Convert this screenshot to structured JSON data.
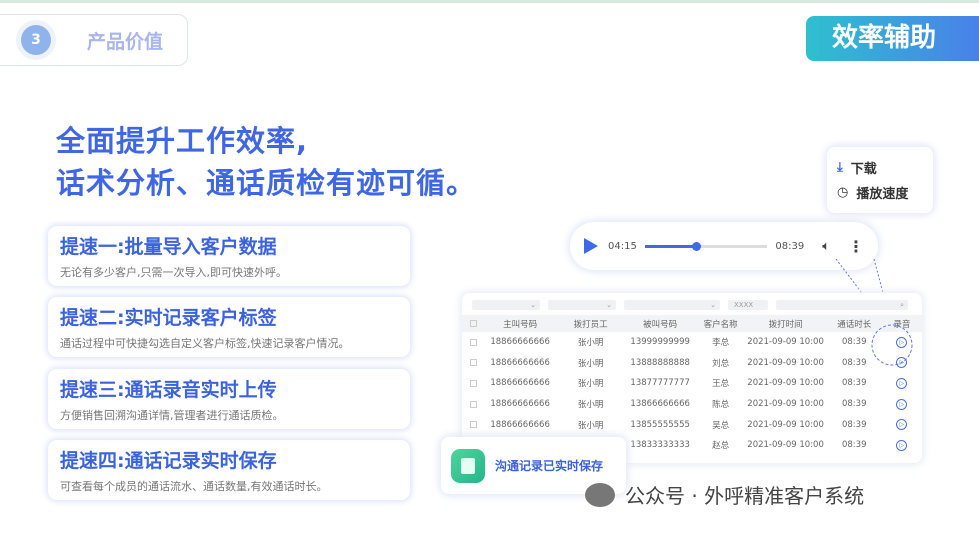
{
  "section": {
    "number": "3",
    "label": "产品价值"
  },
  "badge": "效率辅助",
  "headline": [
    "全面提升工作效率,",
    "话术分析、通话质检有迹可循。"
  ],
  "cards": [
    {
      "title": "提速一:批量导入客户数据",
      "desc": "无论有多少客户,只需一次导入,即可快速外呼。"
    },
    {
      "title": "提速二:实时记录客户标签",
      "desc": "通话过程中可快捷勾选自定义客户标签,快速记录客户情况。"
    },
    {
      "title": "提速三:通话录音实时上传",
      "desc": "方便销售回溯沟通详情,管理者进行通话质检。"
    },
    {
      "title": "提速四:通话记录实时保存",
      "desc": "可查看每个成员的通话流水、通话数量,有效通话时长。"
    }
  ],
  "player": {
    "current": "04:15",
    "total": "08:39",
    "progress": 0.42
  },
  "menu": {
    "download": "下载",
    "speed": "播放速度"
  },
  "table": {
    "filter_placeholder": "XXXX",
    "headers": [
      "主叫号码",
      "拨打员工",
      "被叫号码",
      "客户名称",
      "拨打时间",
      "通话时长",
      "录音"
    ],
    "rows": [
      [
        "18866666666",
        "张小明",
        "13999999999",
        "李总",
        "2021-09-09 10:00",
        "08:39"
      ],
      [
        "18866666666",
        "张小明",
        "13888888888",
        "刘总",
        "2021-09-09 10:00",
        "08:39"
      ],
      [
        "18866666666",
        "张小明",
        "13877777777",
        "王总",
        "2021-09-09 10:00",
        "08:39"
      ],
      [
        "18866666666",
        "张小明",
        "13866666666",
        "陈总",
        "2021-09-09 10:00",
        "08:39"
      ],
      [
        "18866666666",
        "张小明",
        "13855555555",
        "吴总",
        "2021-09-09 10:00",
        "08:39"
      ],
      [
        "18866666666",
        "张小明",
        "13833333333",
        "赵总",
        "2021-09-09 10:00",
        "08:39"
      ]
    ]
  },
  "toast": "沟通记录已实时保存",
  "watermark": "公众号 · 外呼精准客户系统"
}
